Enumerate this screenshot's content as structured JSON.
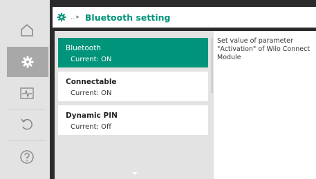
{
  "header": {
    "icon": "gear-icon",
    "breadcrumb": "..",
    "breadcrumb_arrow": "▸",
    "title": "Bluetooth setting"
  },
  "sidebar": {
    "items": [
      {
        "icon": "home-icon",
        "active": false
      },
      {
        "icon": "settings-icon",
        "active": true
      },
      {
        "icon": "diagnostics-icon",
        "active": false
      },
      {
        "icon": "undo-icon",
        "active": false
      },
      {
        "icon": "help-icon",
        "active": false
      }
    ]
  },
  "list": {
    "items": [
      {
        "title": "Bluetooth",
        "value": "Current:  ON",
        "selected": true
      },
      {
        "title": "Connectable",
        "value": "Current:  ON",
        "selected": false
      },
      {
        "title": "Dynamic PIN",
        "value": "Current: Off",
        "selected": false
      }
    ]
  },
  "help": {
    "text": "Set value of parameter \"Activation\" of Wilo Connect Module"
  },
  "colors": {
    "accent": "#00947a",
    "background": "#2b2b2b",
    "sidebar": "#e3e3e3"
  }
}
